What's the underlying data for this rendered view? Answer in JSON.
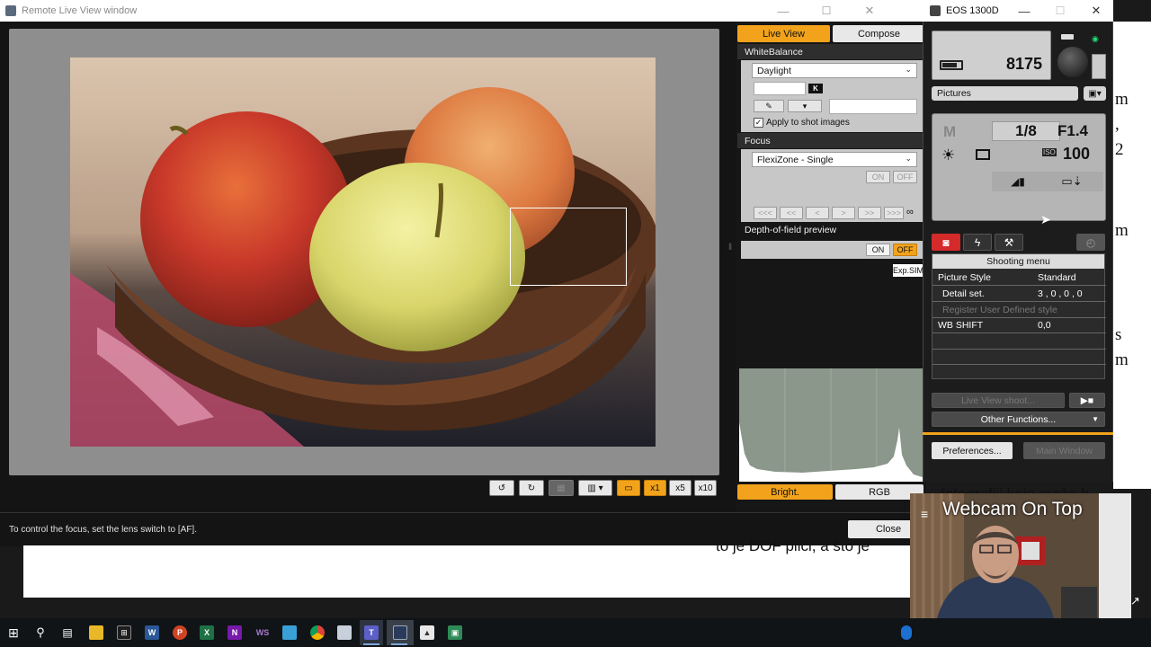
{
  "remote_window": {
    "title": "Remote Live View window",
    "status_text": "To control the focus, set the lens switch to [AF].",
    "close_label": "Close",
    "toolbar": {
      "rotate_left": "↺",
      "rotate_right": "↻",
      "grid": "▦",
      "aspect": "▥ ▾",
      "frame": "▭",
      "zoom_x1": "x1",
      "zoom_x5": "x5",
      "zoom_x10": "x10"
    },
    "tabs": {
      "live_view": "Live View",
      "compose": "Compose"
    },
    "white_balance": {
      "header": "WhiteBalance",
      "selected": "Daylight",
      "k_label": "K",
      "apply_label": "Apply to shot images",
      "apply_checked": true
    },
    "focus": {
      "header": "Focus",
      "mode": "FlexiZone - Single",
      "on": "ON",
      "off": "OFF",
      "nav": [
        "<<<",
        "<<",
        "<",
        ">",
        ">>",
        ">>>",
        "∞"
      ]
    },
    "dof": {
      "header": "Depth-of-field preview",
      "on": "ON",
      "off": "OFF"
    },
    "exp_sim": "Exp.SIM",
    "histogram_tabs": {
      "bright": "Bright.",
      "rgb": "RGB"
    }
  },
  "eos_window": {
    "title": "EOS 1300D",
    "shots_remaining": "8175",
    "save_to": "Pictures",
    "mode": "M",
    "shutter": "1/8",
    "aperture": "F1.4",
    "iso": "100",
    "menu_title": "Shooting menu",
    "menu_rows": [
      {
        "key": "Picture Style",
        "value": "Standard",
        "dim": false
      },
      {
        "key": "Detail set.",
        "value": "3 , 0 , 0 , 0",
        "dim": false
      },
      {
        "key": "Register User Defined style",
        "value": "",
        "dim": true
      },
      {
        "key": "WB SHIFT",
        "value": "0,0",
        "dim": false
      }
    ],
    "live_view_shoot": "Live View shoot...",
    "other_functions": "Other Functions...",
    "preferences": "Preferences...",
    "main_window": "Main Window"
  },
  "background_doc": {
    "bottom_line": "to je DOF plići, a što je",
    "right_line": "fotografiji koje može b",
    "side_chars": [
      "m",
      ",",
      "2",
      "m",
      "s",
      "m"
    ]
  },
  "webcam": {
    "title": "Webcam On Top"
  },
  "colors": {
    "accent": "#f2a31b",
    "panel": "#161616"
  }
}
